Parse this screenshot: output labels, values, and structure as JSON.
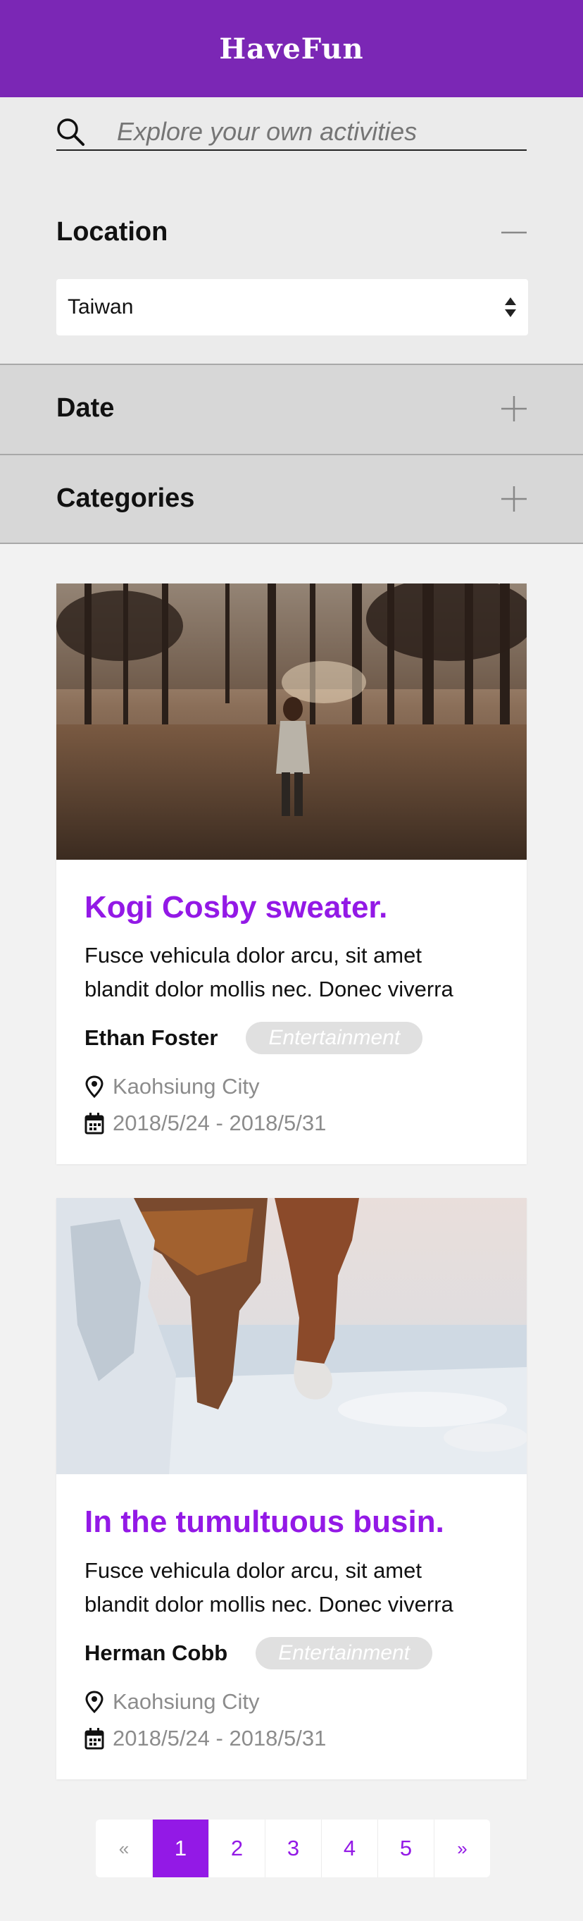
{
  "header": {
    "brand": "HaveFun"
  },
  "search": {
    "placeholder": "Explore your own activities",
    "icon": "search-icon"
  },
  "filters": {
    "location": {
      "title": "Location",
      "selected": "Taiwan",
      "expanded": true
    },
    "date": {
      "title": "Date",
      "expanded": false
    },
    "categories": {
      "title": "Categories",
      "expanded": false
    }
  },
  "cards": [
    {
      "title": "Kogi Cosby sweater.",
      "description": "Fusce vehicula dolor arcu, sit amet blandit dolor mollis nec. Donec viverra",
      "author": "Ethan Foster",
      "tag": "Entertainment",
      "location": "Kaohsiung City",
      "dates": "2018/5/24 - 2018/5/31",
      "image": "woman-in-forest-photo"
    },
    {
      "title": "In the tumultuous busin.",
      "description": "Fusce vehicula dolor arcu, sit amet blandit dolor mollis nec. Donec viverra",
      "author": "Herman Cobb",
      "tag": "Entertainment",
      "location": "Kaohsiung City",
      "dates": "2018/5/24 - 2018/5/31",
      "image": "icy-rock-arch-photo"
    }
  ],
  "pagination": {
    "prev": "«",
    "pages": [
      "1",
      "2",
      "3",
      "4",
      "5"
    ],
    "active": "1",
    "next": "»"
  },
  "colors": {
    "brand": "#7b27b5",
    "accent": "#9319e6"
  }
}
